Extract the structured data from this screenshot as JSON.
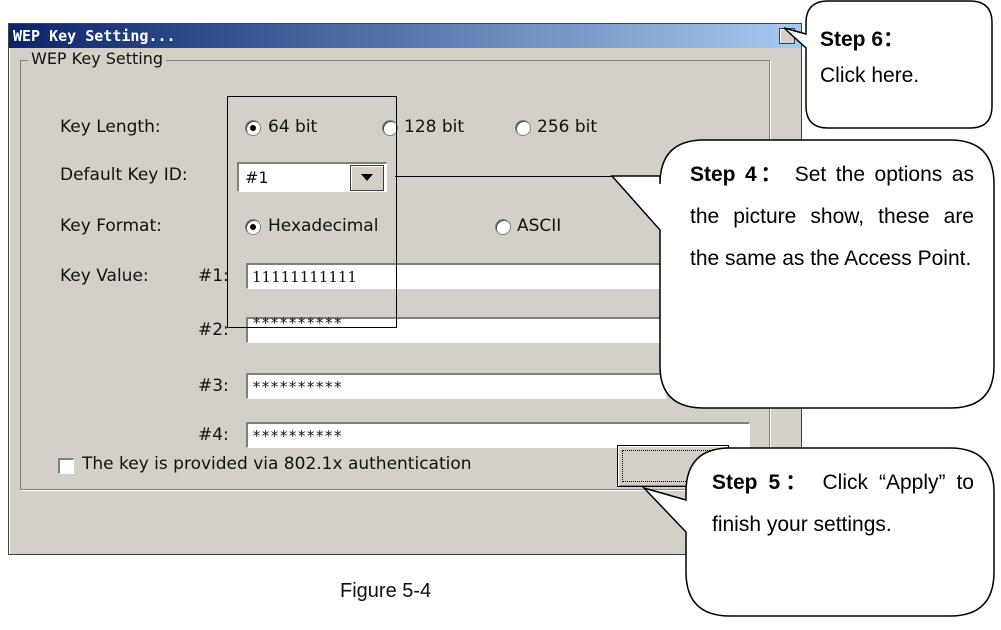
{
  "window": {
    "title": "WEP Key Setting..."
  },
  "group": {
    "label": "WEP Key Setting"
  },
  "key_length": {
    "label": "Key Length:",
    "options": [
      "64 bit",
      "128 bit",
      "256 bit"
    ],
    "selected": "64 bit"
  },
  "default_key": {
    "label": "Default Key ID:",
    "value": "#1"
  },
  "key_format": {
    "label": "Key Format:",
    "options": [
      "Hexadecimal",
      "ASCII"
    ],
    "selected": "Hexadecimal"
  },
  "key_value": {
    "label": "Key Value:",
    "entries": [
      {
        "id": "#1:",
        "value": "11111111111"
      },
      {
        "id": "#2:",
        "value": "**********"
      },
      {
        "id": "#3:",
        "value": "**********"
      },
      {
        "id": "#4:",
        "value": "**********"
      }
    ]
  },
  "checkbox": {
    "label": "The key is provided via 802.1x authentication",
    "checked": false
  },
  "caption": "Figure 5-4",
  "callouts": {
    "step6": {
      "head": "Step 6：",
      "body": "Click here."
    },
    "step4": {
      "head": "Step 4：",
      "body": "Set the options as the picture show, these are the same as the Access Point."
    },
    "step5": {
      "head": "Step 5：",
      "body": "Click “Apply” to finish your settings."
    }
  }
}
